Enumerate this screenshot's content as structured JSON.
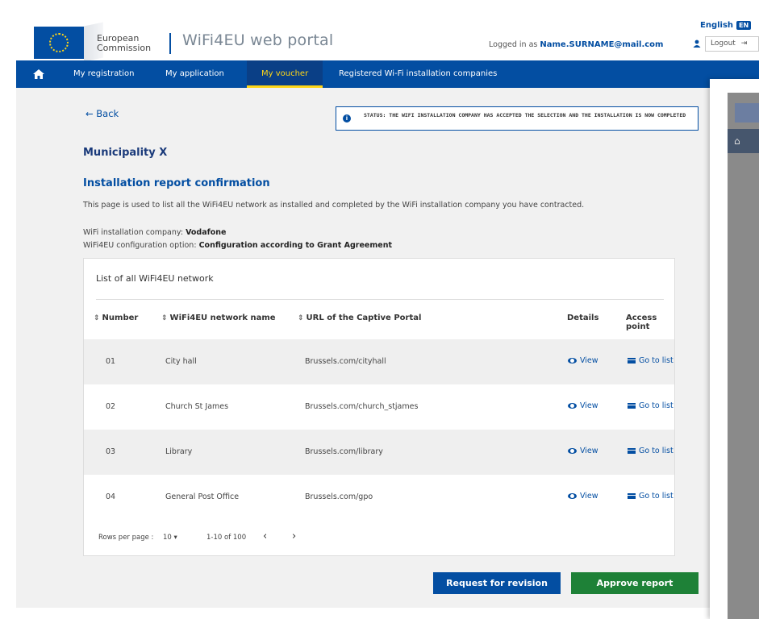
{
  "header": {
    "ec_line1": "European",
    "ec_line2": "Commission",
    "portal_title": "WiFi4EU web portal",
    "logged_in_prefix": "Logged in as",
    "user_email": "Name.SURNAME@mail.com",
    "language": "English",
    "language_code": "EN",
    "logout_label": "Logout"
  },
  "nav": {
    "items": [
      {
        "label": "My registration"
      },
      {
        "label": "My application"
      },
      {
        "label": "My voucher"
      },
      {
        "label": "Registered Wi-Fi installation companies"
      }
    ],
    "active": "My voucher"
  },
  "page": {
    "back_label": "← Back",
    "status_text": "STATUS: THE WIFI INSTALLATION COMPANY HAS ACCEPTED THE SELECTION AND THE INSTALLATION IS NOW COMPLETED",
    "municipality": "Municipality X",
    "section_title": "Installation report confirmation",
    "description": "This page is used to list all the WiFi4EU network as installed and completed by the WiFi installation company you have contracted.",
    "company_label": "WiFi installation company:",
    "company_value": "Vodafone",
    "config_label": "WiFi4EU configuration option:",
    "config_value": "Configuration according to Grant Agreement"
  },
  "table": {
    "caption": "List of all WiFi4EU network",
    "headers": {
      "number": "Number",
      "name": "WiFi4EU network name",
      "url": "URL of the Captive Portal",
      "details": "Details",
      "access_point": "Access point"
    },
    "rows": [
      {
        "number": "01",
        "name": "City hall",
        "url": "Brussels.com/cityhall",
        "view": "View",
        "list": "Go to list"
      },
      {
        "number": "02",
        "name": "Church St James",
        "url": "Brussels.com/church_stjames",
        "view": "View",
        "list": "Go to list"
      },
      {
        "number": "03",
        "name": "Library",
        "url": "Brussels.com/library",
        "view": "View",
        "list": "Go to list"
      },
      {
        "number": "04",
        "name": "General Post Office",
        "url": "Brussels.com/gpo",
        "view": "View",
        "list": "Go to list"
      }
    ],
    "pager": {
      "rows_per_page_label": "Rows per page :",
      "rows_per_page_value": "10 ▾",
      "range": "1-10 of 100",
      "prev": "‹",
      "next": "›"
    }
  },
  "actions": {
    "revision_label": "Request for revision",
    "approve_label": "Approve report"
  },
  "colors": {
    "brand_blue": "#034ea2",
    "approve_green": "#1e8137",
    "active_nav_accent": "#ffd617"
  }
}
